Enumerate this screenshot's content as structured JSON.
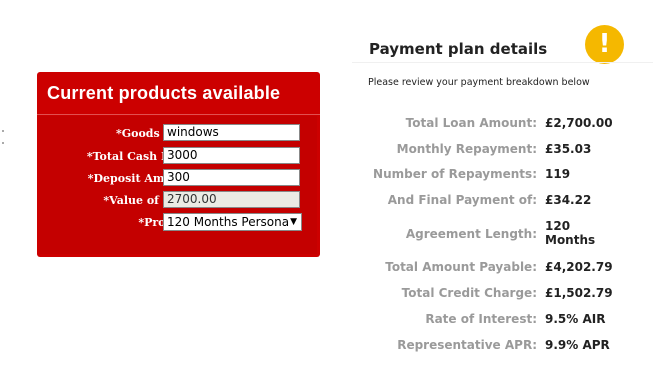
{
  "form": {
    "title": "Current products available",
    "fields": [
      {
        "label": "*Goods Desc:",
        "value": "windows"
      },
      {
        "label": "*Total Cash Price:",
        "value": "3000"
      },
      {
        "label": "*Deposit Amount:",
        "value": "300"
      },
      {
        "label": "*Value of Loan:",
        "value": "2700.00"
      }
    ],
    "product": {
      "label": "*Product:",
      "selected": "120 Months Persona"
    }
  },
  "plan": {
    "title": "Payment plan details",
    "subtitle": "Please review your payment breakdown below",
    "rows": [
      {
        "label": "Total Loan Amount:",
        "value": "£2,700.00"
      },
      {
        "label": "Monthly Repayment:",
        "value": "£35.03"
      },
      {
        "label": "Number of Repayments:",
        "value": "119"
      },
      {
        "label": "And Final Payment of:",
        "value": "£34.22"
      },
      {
        "label": "Agreement Length:",
        "value_line1": "120",
        "value_line2": "Months"
      },
      {
        "label": "Total Amount Payable:",
        "value": "£4,202.79"
      },
      {
        "label": "Total Credit Charge:",
        "value": "£1,502.79"
      },
      {
        "label": "Rate of Interest:",
        "value": "9.5% AIR"
      },
      {
        "label": "Representative APR:",
        "value": "9.9% APR"
      }
    ]
  },
  "icons": {
    "warning": "exclamation-icon"
  },
  "colors": {
    "form_red": "#cc0000",
    "warning": "#f5b800",
    "label_grey": "#9a9a9a"
  }
}
